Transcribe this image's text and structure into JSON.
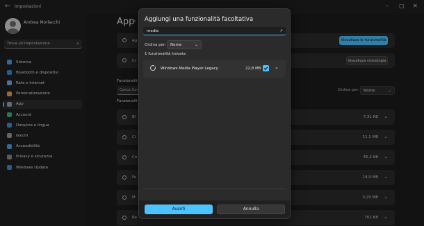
{
  "window": {
    "title": "Impostazioni",
    "back_icon": "back-arrow-icon",
    "controls": [
      "minimize-icon",
      "maximize-icon",
      "close-icon"
    ]
  },
  "user": {
    "name": "Andrea Morlacchi"
  },
  "sidebar": {
    "search_placeholder": "Trova un'impostazione",
    "items": [
      {
        "label": "Sistema",
        "icon": "monitor-icon",
        "color": "#4aa3e8",
        "active": false
      },
      {
        "label": "Bluetooth e dispositivi",
        "icon": "bluetooth-icon",
        "color": "#3d8fd8",
        "active": false
      },
      {
        "label": "Rete e Internet",
        "icon": "wifi-icon",
        "color": "#6fb3e8",
        "active": false
      },
      {
        "label": "Personalizzazione",
        "icon": "brush-icon",
        "color": "#e8a35a",
        "active": false
      },
      {
        "label": "App",
        "icon": "apps-icon",
        "color": "#8aa6c4",
        "active": true
      },
      {
        "label": "Account",
        "icon": "account-icon",
        "color": "#3fb37f",
        "active": false
      },
      {
        "label": "Data/ora e lingua",
        "icon": "globe-clock-icon",
        "color": "#3d8fd8",
        "active": false
      },
      {
        "label": "Giochi",
        "icon": "gamepad-icon",
        "color": "#9a9a9a",
        "active": false
      },
      {
        "label": "Accessibilità",
        "icon": "accessibility-icon",
        "color": "#4aa3e8",
        "active": false
      },
      {
        "label": "Privacy e sicurezza",
        "icon": "shield-icon",
        "color": "#8c8c8c",
        "active": false
      },
      {
        "label": "Windows Update",
        "icon": "update-icon",
        "color": "#3d8fd8",
        "active": false
      }
    ]
  },
  "main": {
    "title": "App",
    "card1_label": "Ag",
    "card1_button": "Visualizza le funzionalità",
    "card2_label": "Cr",
    "card2_button": "Visualizza cronologia",
    "section1": "Funzionalit",
    "bg_search_placeholder": "Cerca funzion",
    "sort_label": "Ordina per:",
    "sort_value": "Nome",
    "section2": "Funzionalit",
    "rows": [
      {
        "name": "Bl",
        "size": "7,31 KB"
      },
      {
        "name": "Ci",
        "size": "11,1 MB"
      },
      {
        "name": "Co",
        "size": "45,2 KB"
      },
      {
        "name": "Fa",
        "size": "19,9 MB"
      },
      {
        "name": "M",
        "size": "3,29 MB"
      },
      {
        "name": "Re",
        "size": "762 KB"
      }
    ]
  },
  "dialog": {
    "title": "Aggiungi una funzionalità facoltativa",
    "search_value": "media",
    "sort_label": "Ordina per:",
    "sort_value": "Nome",
    "count_text": "1 funzionalità trovata",
    "item": {
      "name": "Windows Media Player Legacy",
      "size": "22,8 MB",
      "checked": true
    },
    "next_button": "Avanti",
    "cancel_button": "Annulla"
  },
  "colors": {
    "accent": "#4cc2ff",
    "dialog_bg": "#2b2b2b",
    "page_bg": "#1c1c1c"
  }
}
